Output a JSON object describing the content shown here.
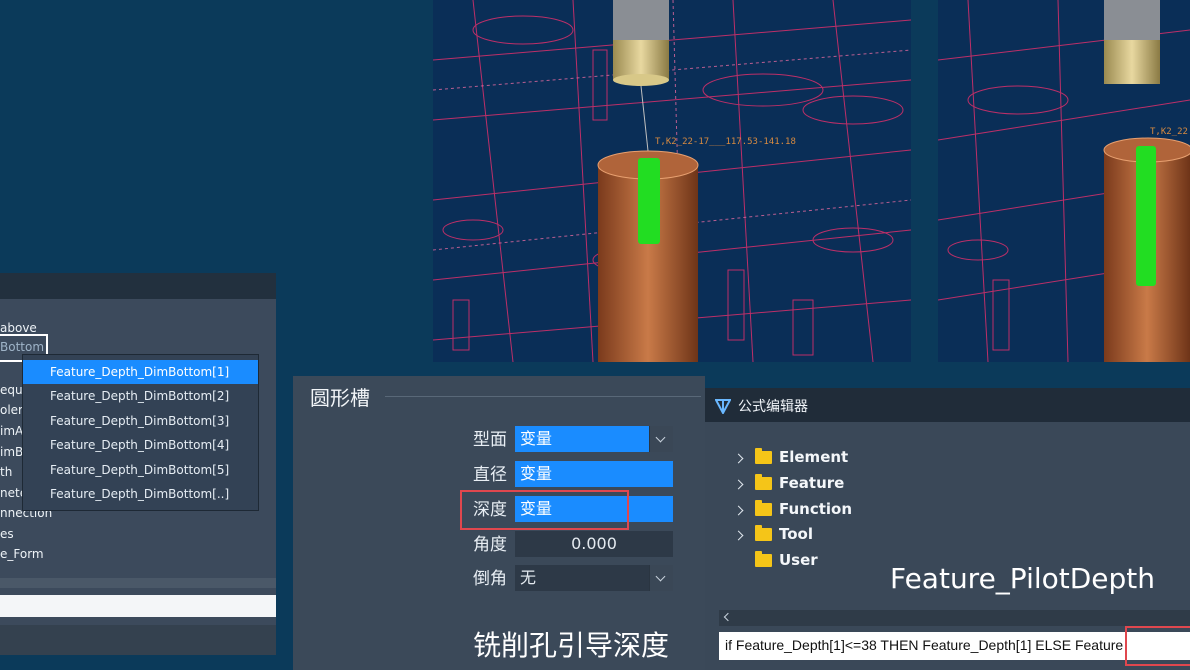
{
  "viewport": {
    "annotation_1": "T,K2_22-17___117.53-141.18",
    "annotation_2": "T,K2_22"
  },
  "left_panel": {
    "visible_labels": [
      "above",
      "equi",
      "olera",
      "imA",
      "imB",
      "th",
      "nete",
      "nnection",
      "es",
      "e_Form"
    ],
    "selected_value": "Bottom",
    "dropdown_items": [
      "Feature_Depth_DimBottom[1]",
      "Feature_Depth_DimBottom[2]",
      "Feature_Depth_DimBottom[3]",
      "Feature_Depth_DimBottom[4]",
      "Feature_Depth_DimBottom[5]",
      "Feature_Depth_DimBottom[..]"
    ],
    "dropdown_selected_index": 0
  },
  "center_panel": {
    "group_title": "圆形槽",
    "fields": {
      "profile": {
        "label": "型面",
        "value": "变量"
      },
      "diameter": {
        "label": "直径",
        "value": "变量"
      },
      "depth": {
        "label": "深度",
        "value": "变量"
      },
      "angle": {
        "label": "角度",
        "value": "0.000"
      },
      "chamfer": {
        "label": "倒角",
        "value": "无"
      }
    },
    "caption": "铣削孔引导深度"
  },
  "formula_editor": {
    "title": "公式编辑器",
    "tree": [
      "Element",
      "Feature",
      "Function",
      "Tool",
      "User"
    ],
    "big_label": "Feature_PilotDepth",
    "formula": "if Feature_Depth[1]<=38 THEN Feature_Depth[1] ELSE Feature"
  },
  "colors": {
    "background": "#0b3a5a",
    "accent_blue": "#1a8cff",
    "highlight_red": "#e0474e",
    "folder_yellow": "#f5c518",
    "wireframe_magenta": "#d0306a",
    "tool_copper": "#b86a3a",
    "toolpath_green": "#22dd22"
  }
}
